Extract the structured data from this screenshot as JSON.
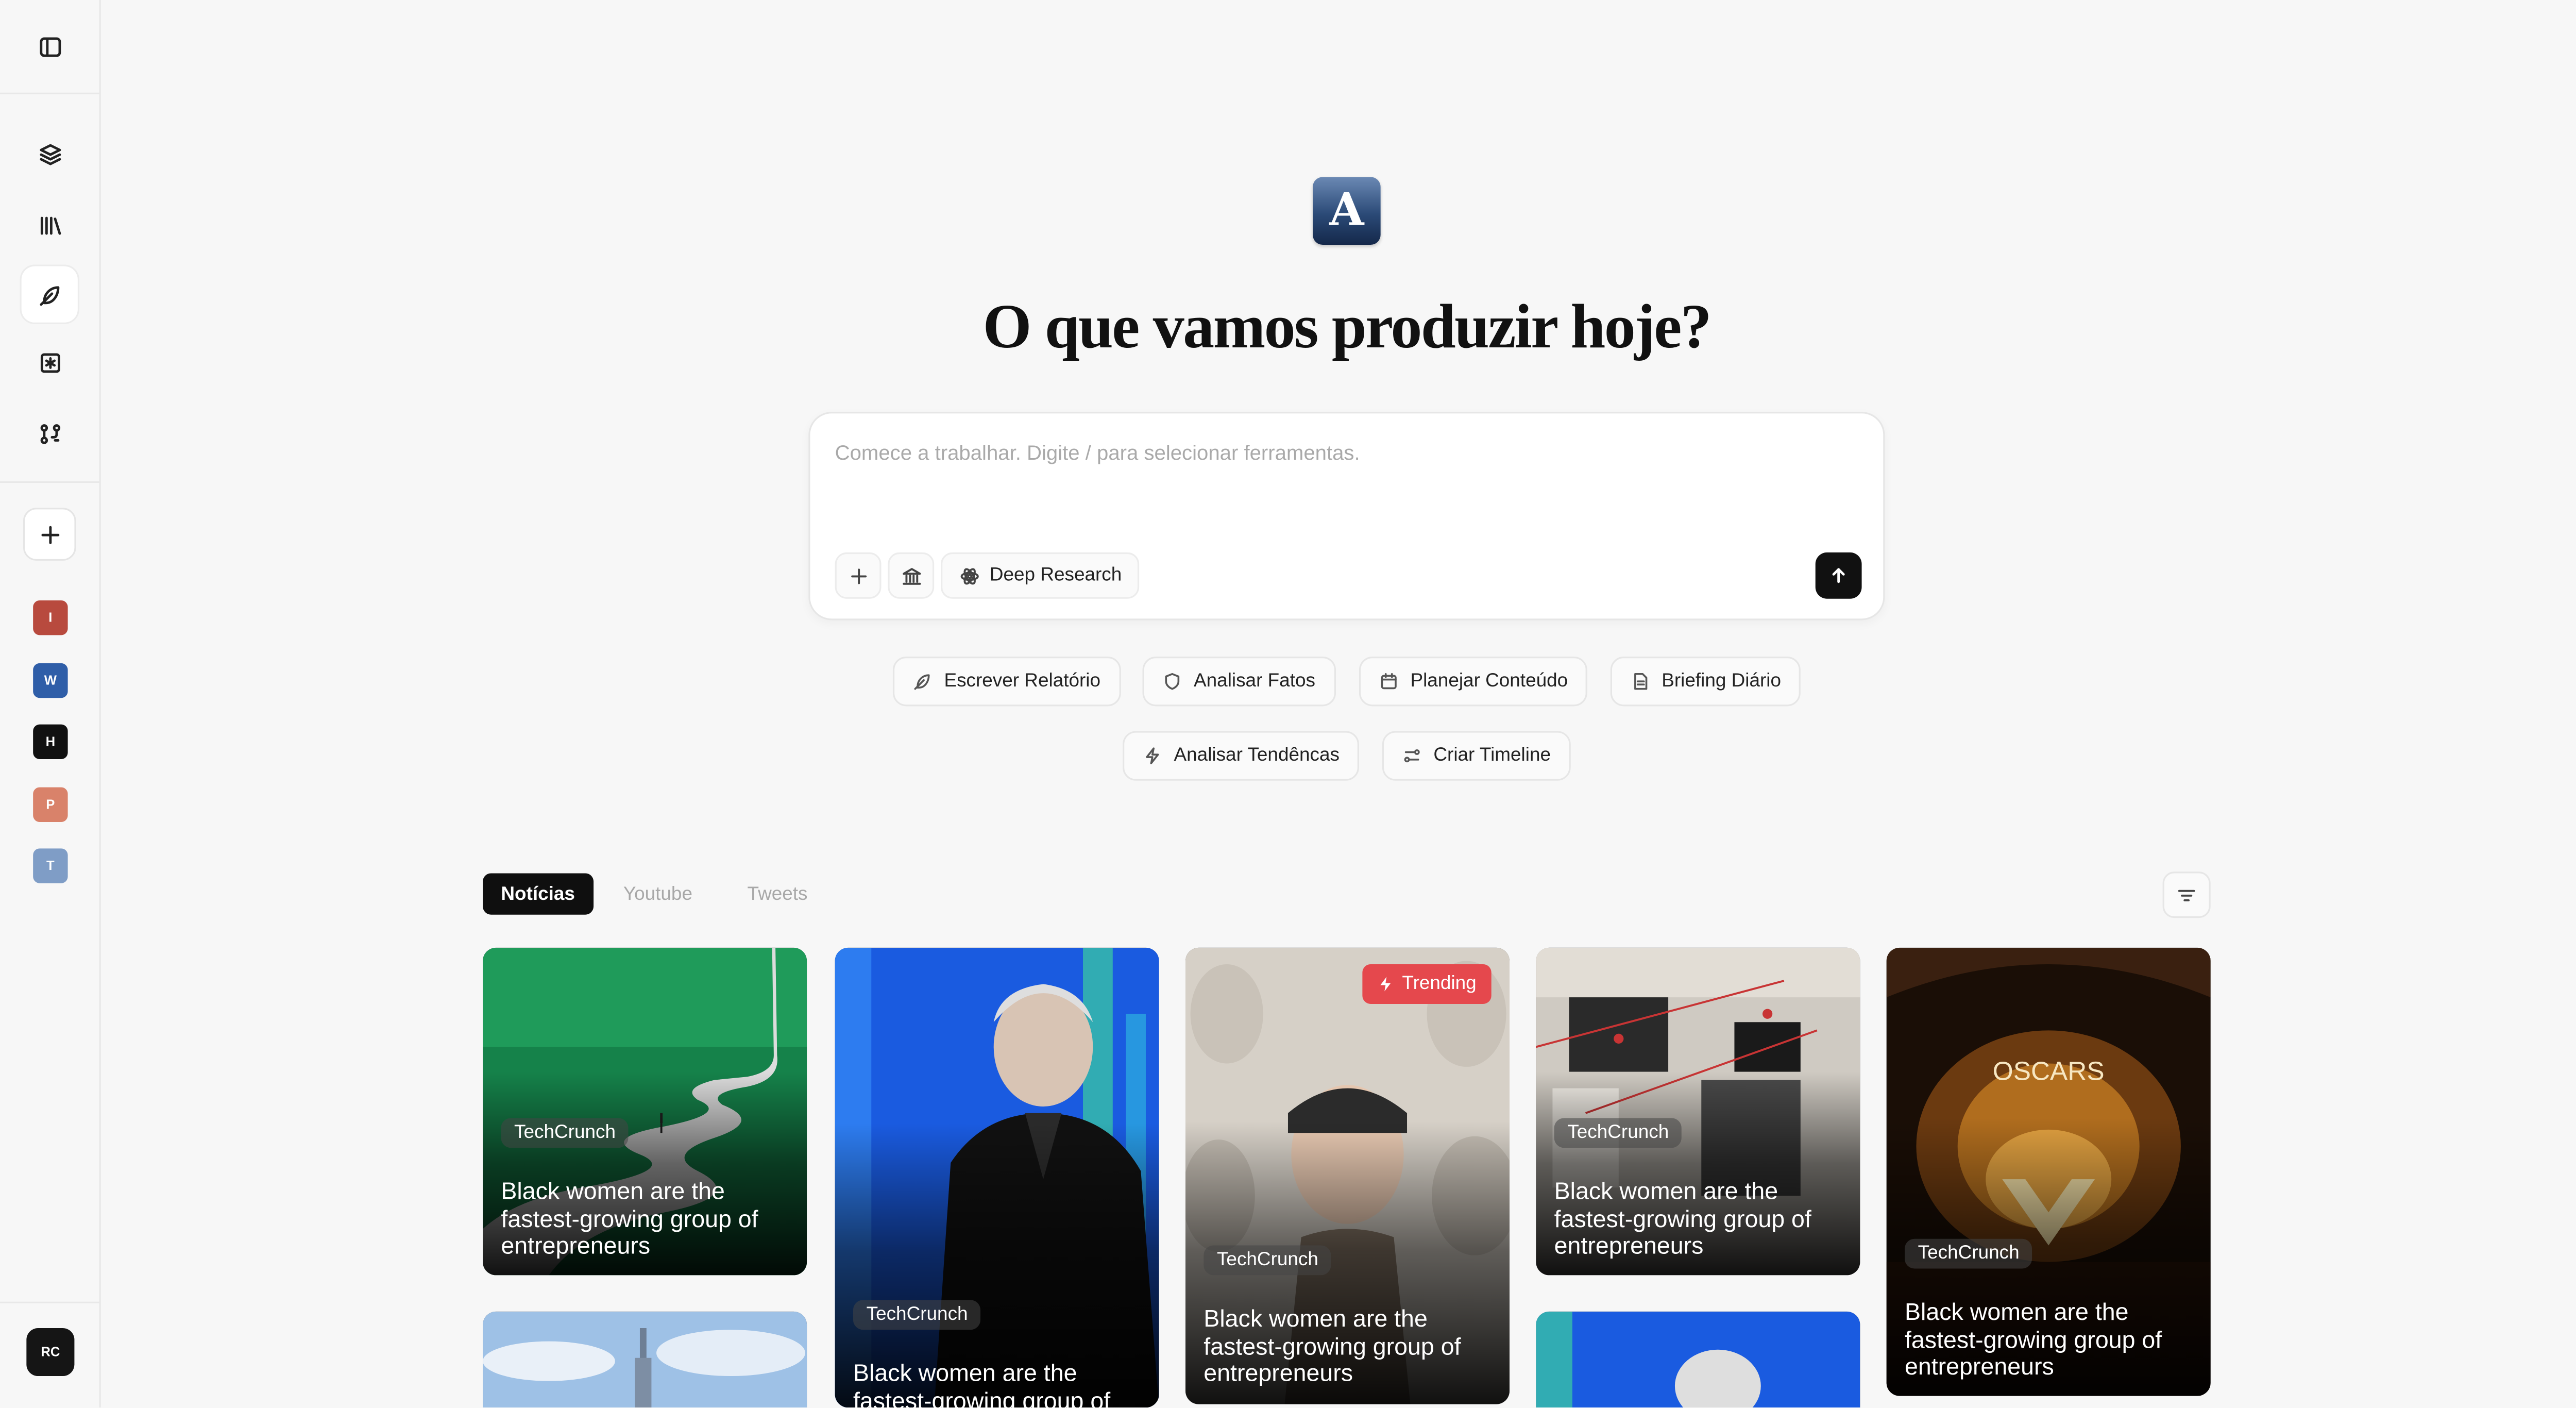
{
  "sidebar": {
    "items": [
      {
        "name": "toggle-sidebar",
        "icon": "sidebar-panel-icon"
      },
      {
        "name": "layers",
        "icon": "layers-icon"
      },
      {
        "name": "library",
        "icon": "library-icon"
      },
      {
        "name": "compose",
        "icon": "feather-icon"
      },
      {
        "name": "asterisk",
        "icon": "asterisk-box-icon"
      },
      {
        "name": "workflows",
        "icon": "nodes-icon"
      }
    ],
    "add_icon": "plus-icon",
    "workspaces": [
      {
        "letter": "I",
        "color": "#b84a3e"
      },
      {
        "letter": "W",
        "color": "#2f5ea8"
      },
      {
        "letter": "H",
        "color": "#111111"
      },
      {
        "letter": "P",
        "color": "#d9826a"
      },
      {
        "letter": "T",
        "color": "#7f9dc6"
      }
    ],
    "user_initials": "RC"
  },
  "main": {
    "logo_letter": "A",
    "heading": "O que vamos produzir hoje?",
    "prompt": {
      "placeholder": "Comece a trabalhar. Digite / para selecionar ferramentas.",
      "deep_research_label": "Deep Research"
    },
    "chips": [
      {
        "label": "Escrever Relatório",
        "icon": "feather-icon"
      },
      {
        "label": "Analisar Fatos",
        "icon": "shield-icon"
      },
      {
        "label": "Planejar Conteúdo",
        "icon": "calendar-icon"
      },
      {
        "label": "Briefing Diário",
        "icon": "document-icon"
      },
      {
        "label": "Analisar Tendêncas",
        "icon": "lightning-icon"
      },
      {
        "label": "Criar Timeline",
        "icon": "timeline-icon"
      }
    ],
    "tabs": [
      {
        "label": "Notícias",
        "active": true
      },
      {
        "label": "Youtube",
        "active": false
      },
      {
        "label": "Tweets",
        "active": false
      }
    ],
    "cards": [
      {
        "source": "TechCrunch",
        "title": "Black women are the fastest-growing group of entrepreneurs",
        "trending": false,
        "image": "green-winding-road-illustration"
      },
      {
        "source": "TechCrunch",
        "title": "Black women are the fastest-growing group of entrepreneurs",
        "trending": false,
        "image": "man-leather-jacket-blue-background"
      },
      {
        "source": "TechCrunch",
        "title": "Black women are the fastest-growing group of entrepreneurs",
        "trending": true,
        "trending_label": "Trending",
        "image": "woman-headset-statues"
      },
      {
        "source": "TechCrunch",
        "title": "Black women are the fastest-growing group of entrepreneurs",
        "trending": false,
        "image": "collage-documents-red-lines"
      },
      {
        "source": "TechCrunch",
        "title": "Black women are the fastest-growing group of entrepreneurs",
        "trending": false,
        "image": "oscars-stage",
        "image_text": "OSCARS"
      },
      {
        "source": "",
        "title": "",
        "trending": false,
        "image": "city-skyline-sky"
      },
      {
        "source": "",
        "title": "",
        "trending": false,
        "image": "blue-background-portrait"
      }
    ]
  }
}
